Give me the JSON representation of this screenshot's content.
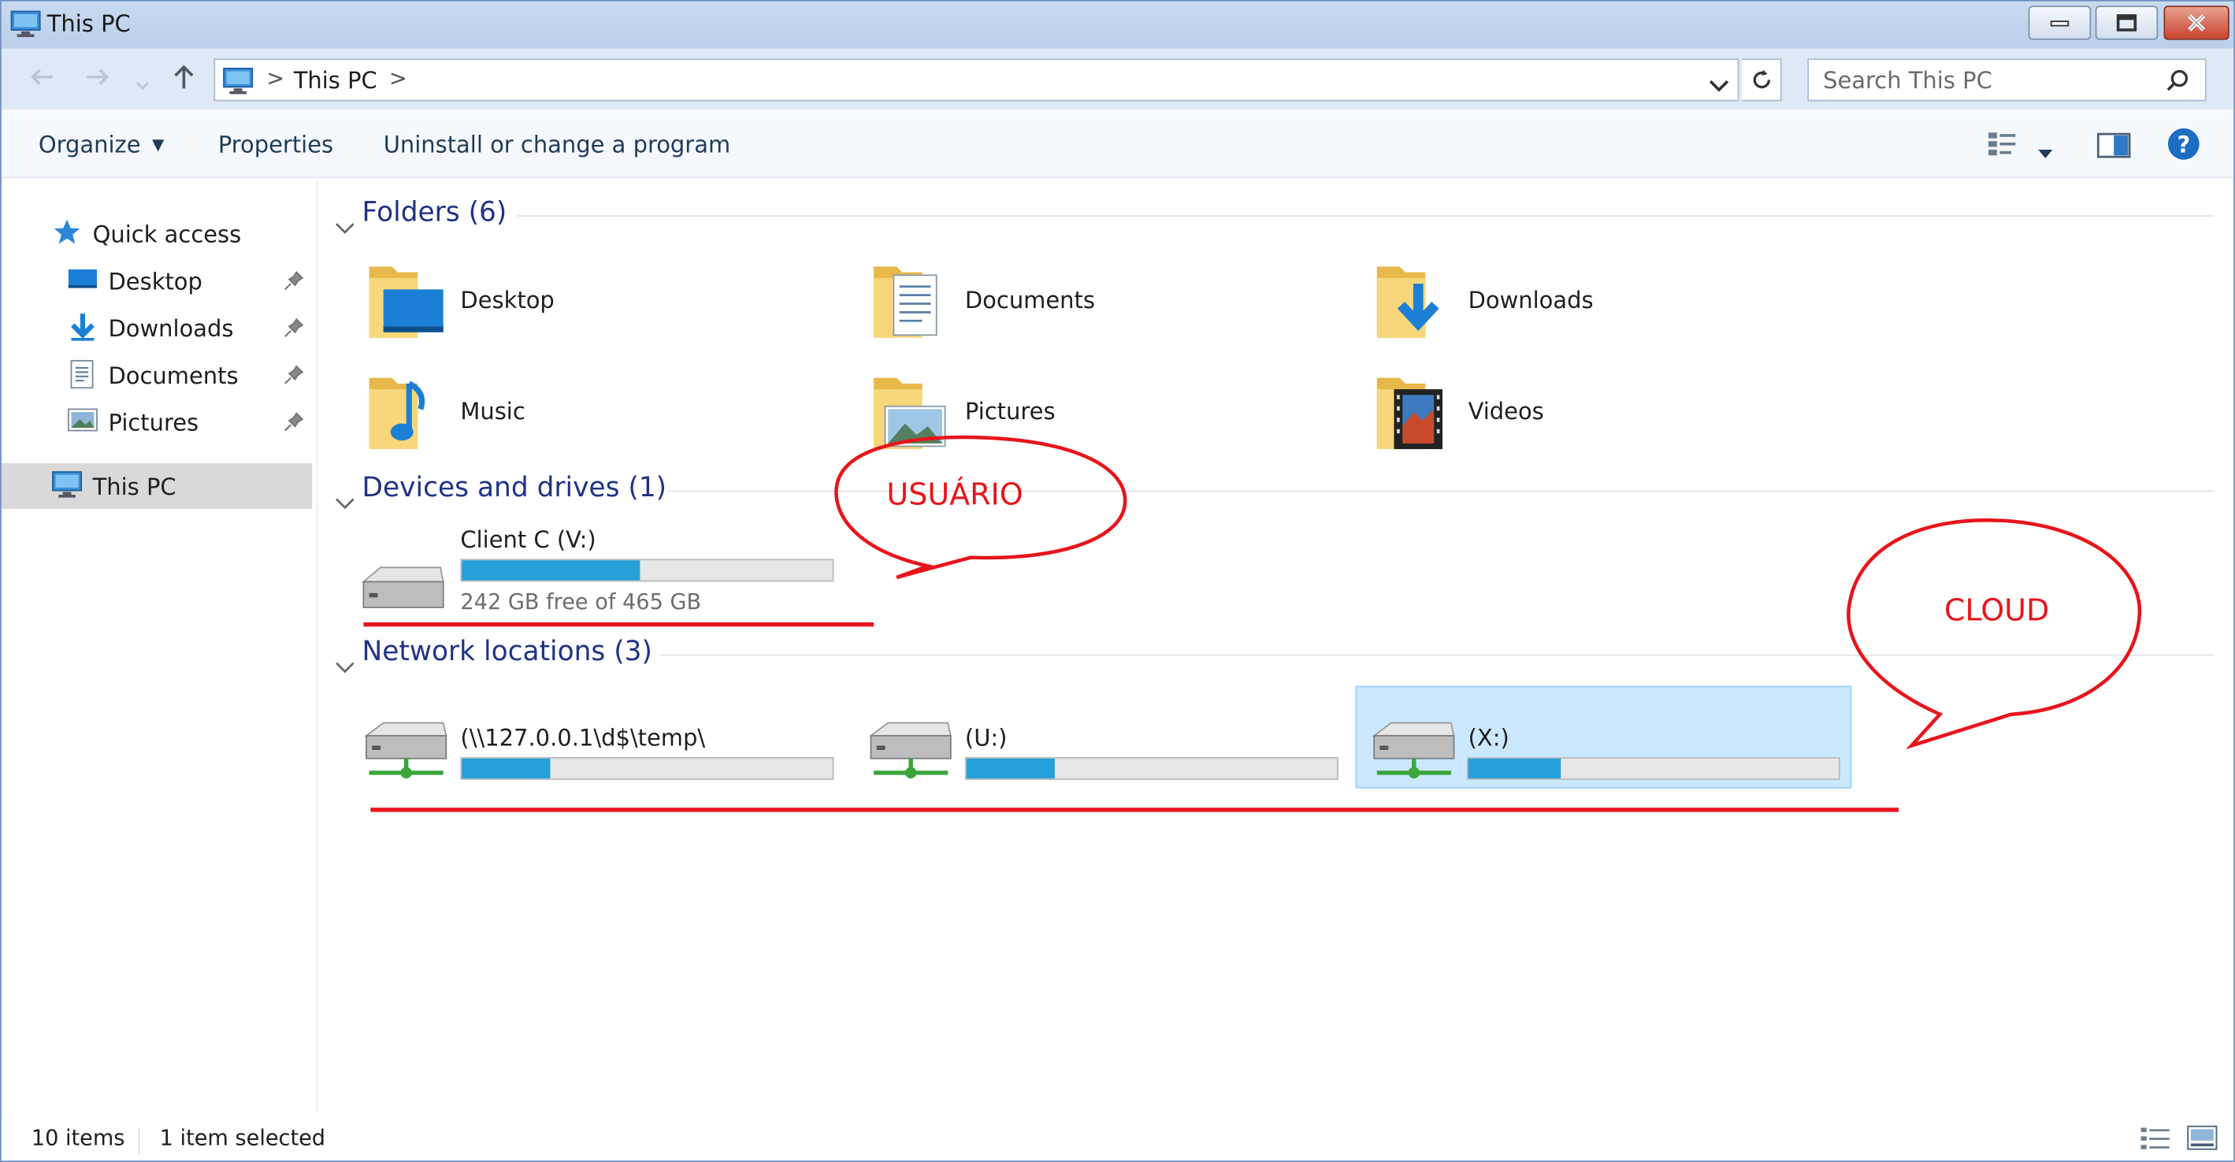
{
  "window": {
    "title": "This PC"
  },
  "addressbar": {
    "crumb": "This PC",
    "separator": ">"
  },
  "search": {
    "placeholder": "Search This PC"
  },
  "commands": {
    "organize": "Organize",
    "properties": "Properties",
    "uninstall": "Uninstall or change a program"
  },
  "sidebar": {
    "quick_access": "Quick access",
    "items": [
      {
        "label": "Desktop",
        "icon": "desktop-icon"
      },
      {
        "label": "Downloads",
        "icon": "downloads-icon"
      },
      {
        "label": "Documents",
        "icon": "documents-icon"
      },
      {
        "label": "Pictures",
        "icon": "pictures-icon"
      }
    ],
    "this_pc": "This PC"
  },
  "groups": {
    "folders": "Folders (6)",
    "devices": "Devices and drives (1)",
    "network": "Network locations (3)"
  },
  "folders": [
    {
      "label": "Desktop",
      "icon": "desktop-folder-icon"
    },
    {
      "label": "Documents",
      "icon": "documents-folder-icon"
    },
    {
      "label": "Downloads",
      "icon": "downloads-folder-icon"
    },
    {
      "label": "Music",
      "icon": "music-folder-icon"
    },
    {
      "label": "Pictures",
      "icon": "pictures-folder-icon"
    },
    {
      "label": "Videos",
      "icon": "videos-folder-icon"
    }
  ],
  "drives": [
    {
      "label": "Client C (V:)",
      "free_text": "242 GB free of 465 GB",
      "used_fraction": 0.48
    }
  ],
  "network_locations": [
    {
      "label": "(\\\\127.0.0.1\\d$\\temp\\",
      "used_fraction": 0.24
    },
    {
      "label": "(U:)",
      "used_fraction": 0.24
    },
    {
      "label": "(X:)",
      "used_fraction": 0.25,
      "selected": true
    }
  ],
  "status": {
    "items": "10 items",
    "selected": "1 item selected"
  },
  "annotations": {
    "usuario": "USUÁRIO",
    "cloud": "CLOUD",
    "color": "#e8141b"
  },
  "colors": {
    "accent": "#26a0da",
    "selection": "#cce8ff",
    "group_header": "#1e3287"
  }
}
